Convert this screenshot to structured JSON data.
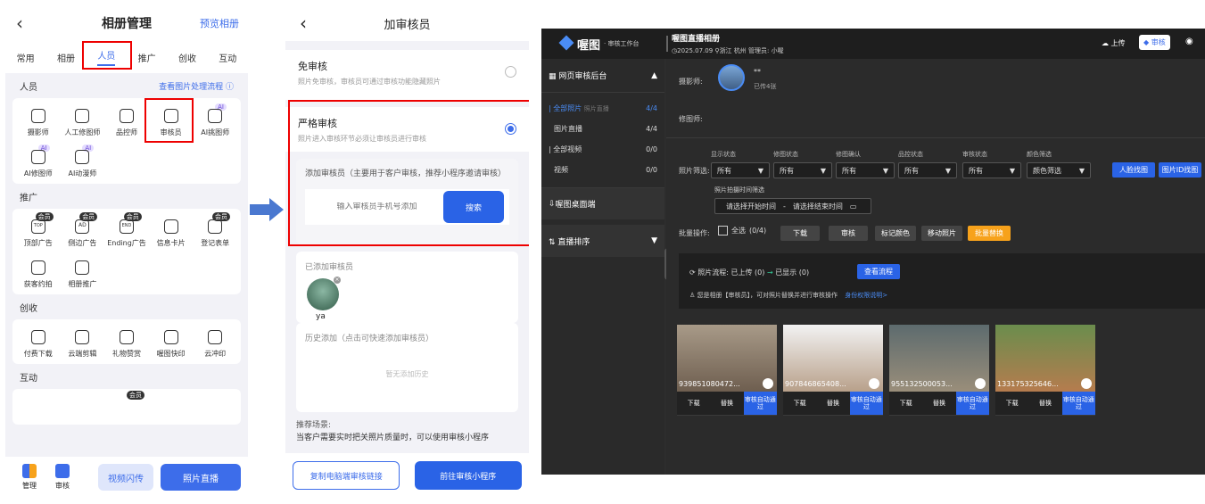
{
  "panel1": {
    "title": "相册管理",
    "preview": "预览相册",
    "tabs": [
      "常用",
      "相册",
      "人员",
      "推广",
      "创收",
      "互动"
    ],
    "people": {
      "title": "人员",
      "link": "查看图片处理流程 ⓘ",
      "items": [
        {
          "label": "摄影师"
        },
        {
          "label": "人工修图师"
        },
        {
          "label": "品控师"
        },
        {
          "label": "审核员"
        },
        {
          "label": "AI挑图师",
          "ai": "AI"
        },
        {
          "label": "AI修图师",
          "ai": "AI"
        },
        {
          "label": "AI动漫师",
          "ai": "AI"
        }
      ]
    },
    "promo": {
      "title": "推广",
      "items": [
        {
          "label": "顶部广告",
          "badge": "会员",
          "glyph": "TOP"
        },
        {
          "label": "侧边广告",
          "badge": "会员",
          "glyph": "AD"
        },
        {
          "label": "Ending广告",
          "badge": "会员",
          "glyph": "END"
        },
        {
          "label": "信息卡片"
        },
        {
          "label": "登记表单",
          "badge": "会员"
        },
        {
          "label": "获客约拍"
        },
        {
          "label": "相册推广"
        }
      ]
    },
    "income": {
      "title": "创收",
      "items": [
        {
          "label": "付费下载"
        },
        {
          "label": "云端剪辑"
        },
        {
          "label": "礼物赞赏"
        },
        {
          "label": "喔图快印"
        },
        {
          "label": "云冲印"
        }
      ]
    },
    "interact": {
      "title": "互动",
      "badge": "会员"
    },
    "bottom": {
      "manage": "管理",
      "review": "审核",
      "video": "视频闪传",
      "live": "照片直播"
    }
  },
  "panel2": {
    "title": "加审核员",
    "free": {
      "title": "免审核",
      "desc": "照片免审核，审核员可通过审核功能隐藏照片"
    },
    "strict": {
      "title": "严格审核",
      "desc": "照片进入审核环节必须让审核员进行审核"
    },
    "add_label": "添加审核员（主要用于客户审核，推荐小程序邀请审核）",
    "input_placeholder": "输入审核员手机号添加",
    "search": "搜索",
    "added_title": "已添加审核员",
    "reviewer_name": "ya",
    "history_title": "历史添加（点击可快速添加审核员）",
    "history_empty": "暂无添加历史",
    "scene_title": "推荐场景:",
    "scene_desc": "当客户需要实时把关照片质量时，可以使用审核小程序",
    "copy_link": "复制电脑端审核链接",
    "goto_mini": "前往审核小程序"
  },
  "panel3": {
    "logo": "喔图",
    "subtitle": "· 审核工作台",
    "album": "喔图直播相册",
    "date": "2025.07.09",
    "location": "浙江 杭州",
    "manager": "管理员: 小喔",
    "upload": "上传",
    "review": "审核",
    "side": {
      "web": "网页审核后台",
      "all_photos": "全部照片",
      "live_tag": "照片直播",
      "all_count": "4/4",
      "photo_live": "图片直播",
      "pl_count": "4/4",
      "all_video": "全部视频",
      "av_count": "0/0",
      "video": "视频",
      "v_count": "0/0",
      "desktop": "喔图桌面端",
      "sort": "直播排序"
    },
    "photographer_label": "摄影师:",
    "photographer_name": "**",
    "uploaded": "已传4张",
    "retoucher_label": "修图师:",
    "filters": {
      "label": "照片筛选:",
      "heads": [
        "显示状态",
        "修图状态",
        "修图确认",
        "品控状态",
        "审核状态",
        "颜色筛选"
      ],
      "values": [
        "所有",
        "所有",
        "所有",
        "所有",
        "所有",
        "颜色筛选"
      ],
      "face": "人脸找图",
      "photo_id": "图片ID找图",
      "time_label": "照片拍摄时间筛选",
      "start": "请选择开始时间",
      "dash": "-",
      "end": "请选择结束时间"
    },
    "batch": {
      "label": "批量操作:",
      "select_all": "全选",
      "count": "(0/4)",
      "download": "下载",
      "review": "审核",
      "mark": "标记颜色",
      "move": "移动照片",
      "replace": "批量替换"
    },
    "flow": {
      "text": "照片流程: 已上传",
      "n1": "(0)",
      "arrow": "→",
      "shown": "已显示",
      "n2": "(0)",
      "btn": "查看流程",
      "note": "您是相册【审核员】，可对照片替换并进行审核操作",
      "perm": "身份权限说明>"
    },
    "photos": [
      {
        "id": "939851080472..."
      },
      {
        "id": "907846865408..."
      },
      {
        "id": "955132500053..."
      },
      {
        "id": "133175325646..."
      }
    ],
    "photo_btns": {
      "download": "下载",
      "replace": "替换",
      "auto": "审核自动通过"
    }
  },
  "colors": {
    "blue": "#3d6dea",
    "red": "#e00000",
    "orange": "#f7a21b"
  }
}
